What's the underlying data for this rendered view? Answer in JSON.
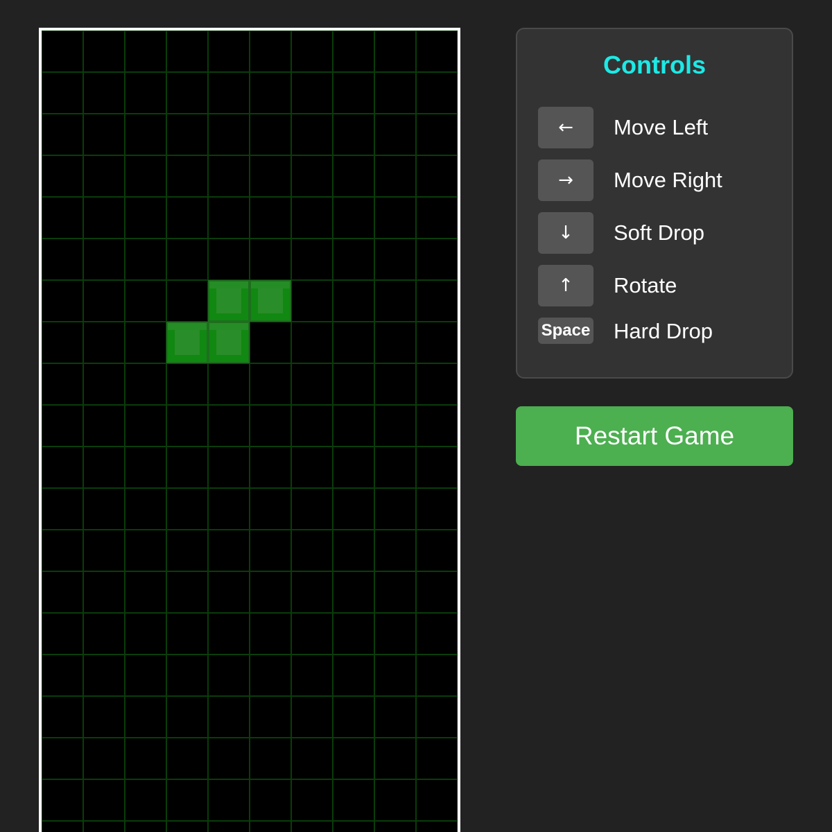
{
  "board": {
    "columns": 10,
    "rows": 20,
    "background_color": "#000000",
    "grid_color": "#0a3d0a",
    "border_color": "#ffffff",
    "active_piece": {
      "type": "S",
      "color": "#118811",
      "highlight_color": "#2f8f2f",
      "cells": [
        {
          "col": 4,
          "row": 6
        },
        {
          "col": 5,
          "row": 6
        },
        {
          "col": 3,
          "row": 7
        },
        {
          "col": 4,
          "row": 7
        }
      ]
    }
  },
  "controls": {
    "title": "Controls",
    "title_color": "#1de9e6",
    "items": [
      {
        "key": "←",
        "action": "Move Left",
        "key_icon": "arrow-left-icon"
      },
      {
        "key": "→",
        "action": "Move Right",
        "key_icon": "arrow-right-icon"
      },
      {
        "key": "↓",
        "action": "Soft Drop",
        "key_icon": "arrow-down-icon"
      },
      {
        "key": "↑",
        "action": "Rotate",
        "key_icon": "arrow-up-icon"
      },
      {
        "key": "Space",
        "action": "Hard Drop",
        "key_icon": "space-key"
      }
    ]
  },
  "restart": {
    "label": "Restart Game",
    "color": "#4caf50"
  }
}
